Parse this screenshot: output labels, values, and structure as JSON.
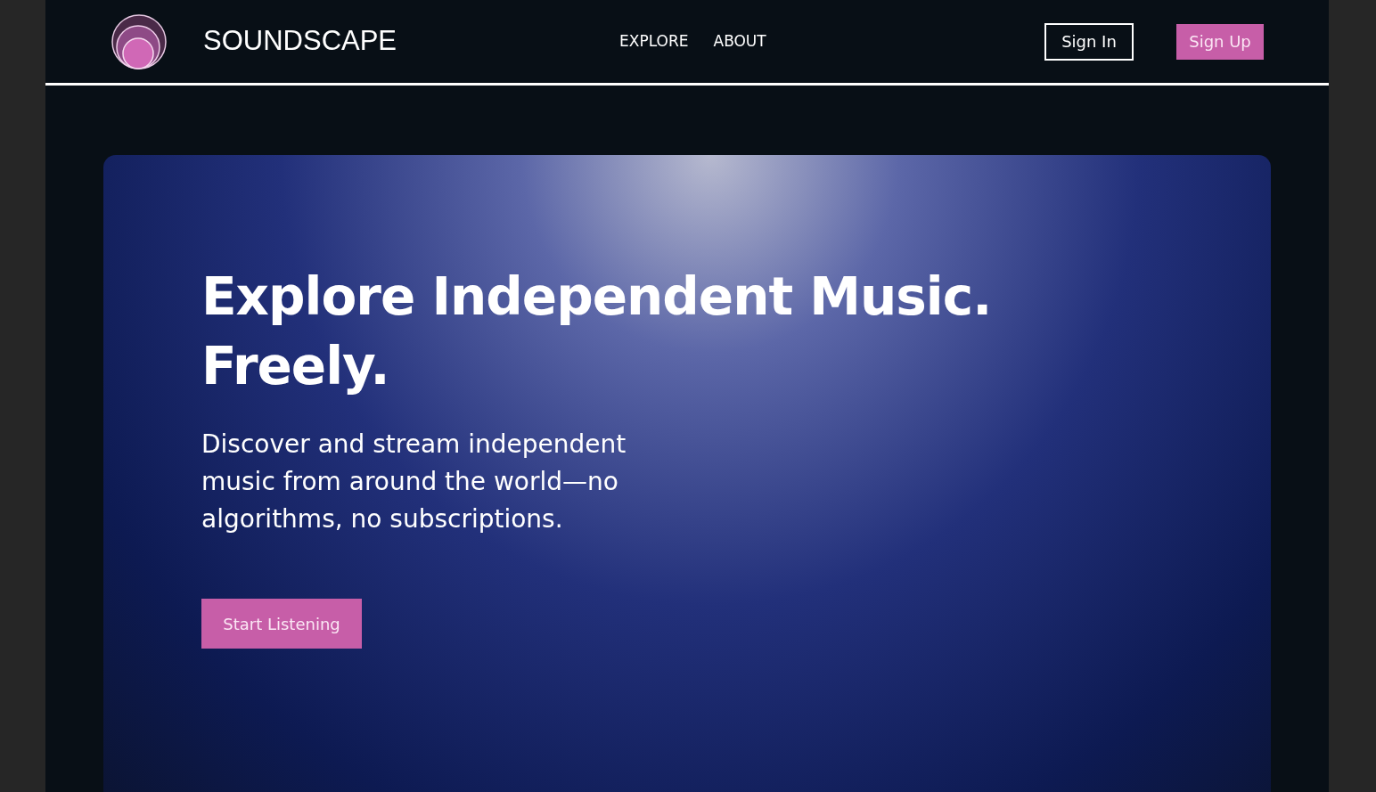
{
  "header": {
    "brand": "SOUNDSCAPE",
    "nav": [
      {
        "label": "EXPLORE"
      },
      {
        "label": "ABOUT"
      }
    ],
    "sign_in": "Sign In",
    "sign_up": "Sign Up"
  },
  "hero": {
    "headline": [
      "Explore Independent Music.",
      "Freely."
    ],
    "description": "Discover and stream independent music from around the world—no algorithms, no subscriptions.",
    "cta": "Start Listening"
  }
}
